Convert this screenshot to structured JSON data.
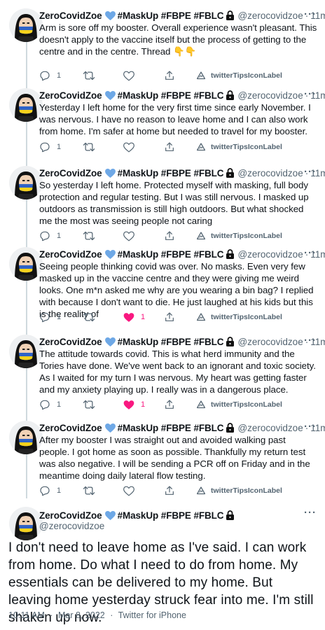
{
  "colors": {
    "text": "#0f1419",
    "secondary": "#536471",
    "like": "#f91880",
    "verified_heart": "#6ea8e6"
  },
  "author": {
    "name": "ZeroCovidZoe",
    "tags": "#MaskUp #FBPE #FBLC",
    "handle": "@zerocovidzoe"
  },
  "tweets": [
    {
      "time": "11m",
      "text": "Arm is sore off my booster. Overall experience wasn't pleasant. This doesn't apply to the vaccine itself but the process of getting to the centre and in the centre. Thread 👇👇",
      "reply_count": "1",
      "like_count": "",
      "liked": false,
      "tips_label": "twitterTipsIconLabel"
    },
    {
      "time": "11m",
      "text": "Yesterday I left home for the very first time since early November. I was nervous. I have no reason to leave home and I can also work from home. I'm safer at home but needed to travel for my booster.",
      "reply_count": "1",
      "like_count": "",
      "liked": false,
      "tips_label": "twitterTipsIconLabel"
    },
    {
      "time": "11m",
      "text": "So yesterday I left home. Protected myself with masking, full body protection and regular testing. But I was still nervous. I masked up outdoors as transmission is still high outdoors. But what shocked me the most was seeing people not caring",
      "reply_count": "1",
      "like_count": "",
      "liked": false,
      "tips_label": "twitterTipsIconLabel"
    },
    {
      "time": "11m",
      "text": "Seeing people thinking covid was over. No masks. Even very few masked up in the vaccine centre and they were giving me weird looks. One m*n asked me why are you wearing a bin bag? I replied with because I don't want to die. He just laughed at his kids but this is the reality of",
      "reply_count": "1",
      "like_count": "1",
      "liked": true,
      "tips_label": "twitterTipsIconLabel"
    },
    {
      "time": "11m",
      "text": "The attitude towards covid. This is what herd immunity and the Tories have done. We've went back to an ignorant and toxic society. As I waited for my turn I was nervous. My heart was getting faster and my anxiety playing up. I really was in a dangerous place.",
      "reply_count": "1",
      "like_count": "1",
      "liked": true,
      "tips_label": "twitterTipsIconLabel"
    },
    {
      "time": "11m",
      "text": "After my booster I was straight out and avoided walking past people. I got home as soon as possible. Thankfully my return test was also negative. I will be sending a PCR off on Friday and in the meantime doing daily lateral flow testing.",
      "reply_count": "1",
      "like_count": "",
      "liked": false,
      "tips_label": "twitterTipsIconLabel"
    }
  ],
  "main_tweet": {
    "text": "I don't need to leave home as I've said. I can work from home. Do what I need to do from home. My essentials can be delivered to my home. But leaving home yesterday struck fear into me. I'm still shaken up now.",
    "time": "10:11 AM",
    "date": "Mar 8, 2022",
    "source": "Twitter for iPhone",
    "sep": "·"
  }
}
